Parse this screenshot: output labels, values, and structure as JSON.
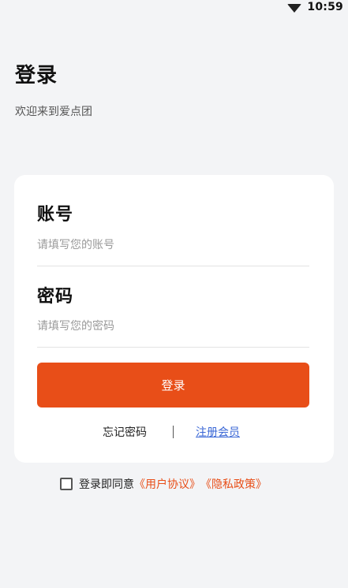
{
  "status_bar": {
    "time": "10:59",
    "wifi_icon": "wifi-icon"
  },
  "header": {
    "title": "登录",
    "subtitle": "欢迎来到爱点团"
  },
  "form": {
    "account_label": "账号",
    "account_placeholder": "请填写您的账号",
    "account_value": "",
    "password_label": "密码",
    "password_placeholder": "请填写您的密码",
    "password_value": "",
    "login_button": "登录",
    "forgot_password": "忘记密码",
    "register": "注册会员"
  },
  "agreement": {
    "checked": false,
    "prefix": "登录即同意",
    "user_agreement": "《用户协议》",
    "privacy_policy": "《隐私政策》"
  },
  "colors": {
    "accent": "#e84e18",
    "link_blue": "#3a67d6",
    "background": "#f3f4f6",
    "card": "#ffffff"
  }
}
